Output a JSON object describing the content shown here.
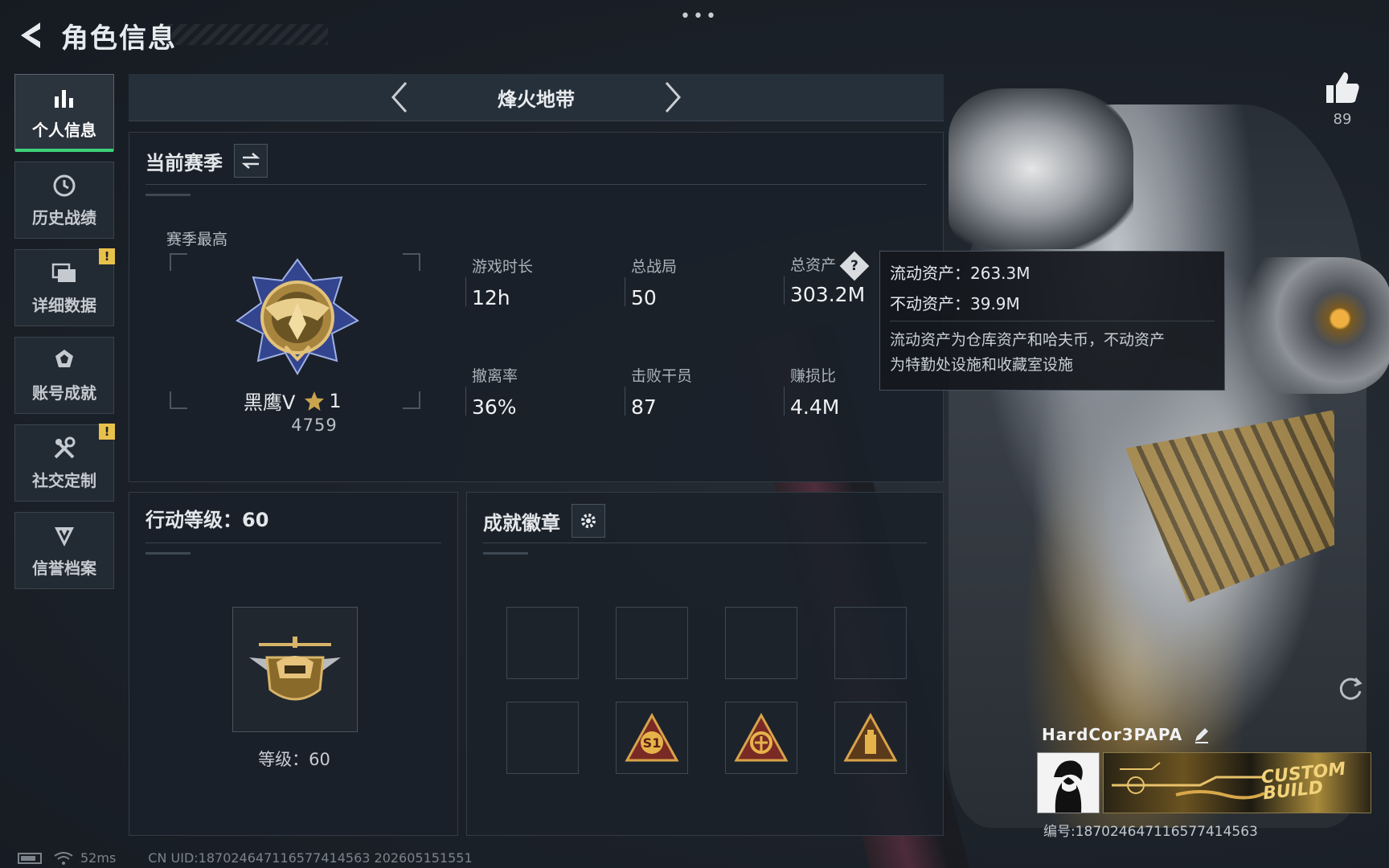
{
  "header": {
    "title": "角色信息"
  },
  "sidebar": {
    "items": [
      {
        "label": "个人信息",
        "icon": "bar-chart-icon",
        "active": true,
        "alert": false
      },
      {
        "label": "历史战绩",
        "icon": "history-clock-icon",
        "active": false,
        "alert": false
      },
      {
        "label": "详细数据",
        "icon": "folder-icon",
        "active": false,
        "alert": true
      },
      {
        "label": "账号成就",
        "icon": "achievement-icon",
        "active": false,
        "alert": false
      },
      {
        "label": "社交定制",
        "icon": "tools-icon",
        "active": false,
        "alert": true
      },
      {
        "label": "信誉档案",
        "icon": "shield-v-icon",
        "active": false,
        "alert": false
      }
    ],
    "alert_mark": "!"
  },
  "mode": {
    "name": "烽火地带"
  },
  "season": {
    "title": "当前赛季",
    "best_label": "赛季最高",
    "rank_name": "黑鹰V",
    "rank_stars": "1",
    "rank_score": "4759",
    "stats": {
      "play_time": {
        "label": "游戏时长",
        "value": "12h"
      },
      "total_matches": {
        "label": "总战局",
        "value": "50"
      },
      "total_assets": {
        "label": "总资产",
        "value": "303.2M"
      },
      "extract_rate": {
        "label": "撤离率",
        "value": "36%"
      },
      "kills": {
        "label": "击败干员",
        "value": "87"
      },
      "profit_ratio": {
        "label": "赚损比",
        "value": "4.4M"
      }
    },
    "help_glyph": "?"
  },
  "tooltip": {
    "liquid": "流动资产：263.3M",
    "fixed": "不动资产：39.9M",
    "desc_1": "流动资产为仓库资产和哈夫币，不动资产",
    "desc_2": "为特勤处设施和收藏室设施"
  },
  "action_level": {
    "title": "行动等级：60",
    "level_text": "等级：60"
  },
  "badges": {
    "title": "成就徽章",
    "badge_s1_text": "S1"
  },
  "likes": {
    "count": "89"
  },
  "player": {
    "name": "HardCor3PAPA",
    "id": "编号:187024647116577414563",
    "banner_text_1": "CUSTOM",
    "banner_text_2": "BUILD"
  },
  "footer": {
    "ping": "52ms",
    "uid": "CN UID:187024647116577414563 202605151551"
  },
  "colors": {
    "accent_green": "#3fd17a",
    "alert_yellow": "#e8c14a",
    "gold": "#c9a44f"
  }
}
